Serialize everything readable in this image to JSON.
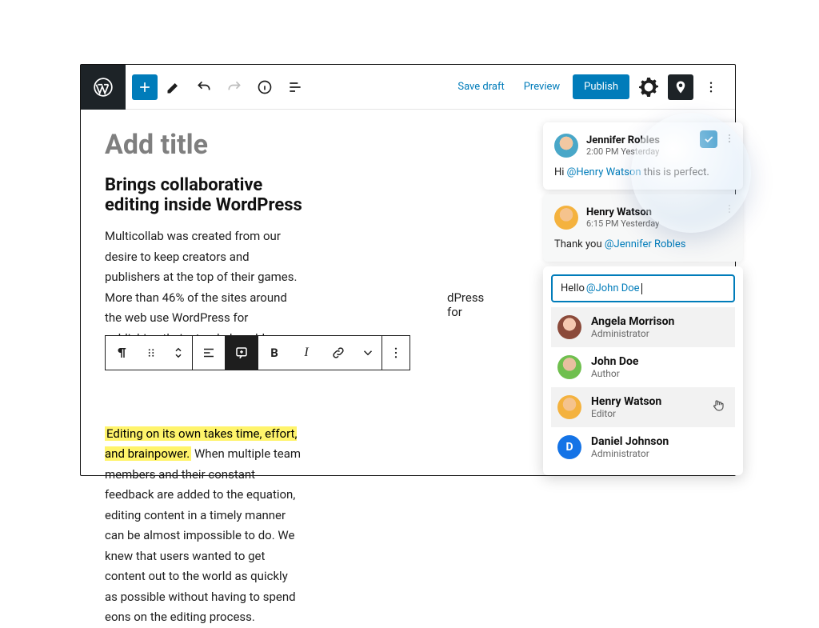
{
  "topbar": {
    "save_draft": "Save draft",
    "preview": "Preview",
    "publish": "Publish"
  },
  "editor": {
    "title_placeholder": "Add title",
    "heading": "Brings collaborative editing inside WordPress",
    "para1": "Multicollab was created from our desire to keep creators and publishers at the top of their games. More than 46% of the sites around the web use WordPress for publishing their stand-alone blog posts, news breaks, and",
    "para1_tail": "dPress for",
    "highlight": "Editing on its own takes time, effort, and brainpower.",
    "para2_tail": " When multiple team members and their constant feedback are added to the equation, editing content in a timely manner can be almost impossible to do. We knew that users wanted to get content out to the world as quickly as possible without having to spend eons on the editing process."
  },
  "comments": [
    {
      "author": "Jennifer Robles",
      "time": "2:00 PM Yesterday",
      "body_pre": "Hi ",
      "mention": "@Henry Watson",
      "body_post": " this is perfect."
    },
    {
      "author": "Henry Watson",
      "time": "6:15 PM Yesterday",
      "body_pre": "Thank you ",
      "mention": "@Jennifer Robles",
      "body_post": ""
    }
  ],
  "reply": {
    "text_pre": "Hello ",
    "mention": "@John Doe"
  },
  "mention_list": [
    {
      "name": "Angela Morrison",
      "role": "Administrator"
    },
    {
      "name": "John Doe",
      "role": "Author"
    },
    {
      "name": "Henry Watson",
      "role": "Editor"
    },
    {
      "name": "Daniel Johnson",
      "role": "Administrator"
    }
  ],
  "block_toolbar": {
    "bold": "B",
    "italic": "I"
  }
}
